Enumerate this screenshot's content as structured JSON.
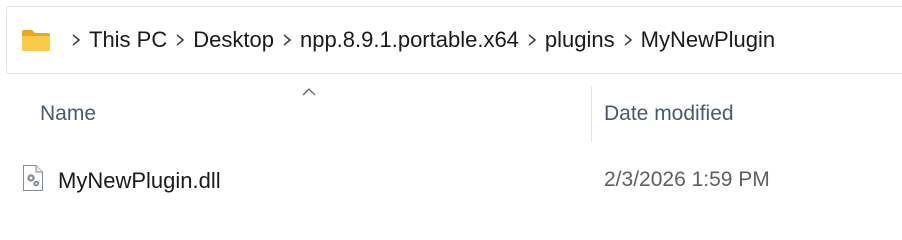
{
  "breadcrumb": {
    "items": [
      {
        "label": "This PC"
      },
      {
        "label": "Desktop"
      },
      {
        "label": "npp.8.9.1.portable.x64"
      },
      {
        "label": "plugins"
      },
      {
        "label": "MyNewPlugin"
      }
    ]
  },
  "columns": {
    "name": "Name",
    "date_modified": "Date modified"
  },
  "files": [
    {
      "name": "MyNewPlugin.dll",
      "date_modified": "2/3/2026 1:59 PM",
      "icon": "dll-file-icon"
    }
  ],
  "colors": {
    "folder": "#f4c53f",
    "header_text": "#4a5a6e",
    "date_text": "#5f5f5f"
  }
}
